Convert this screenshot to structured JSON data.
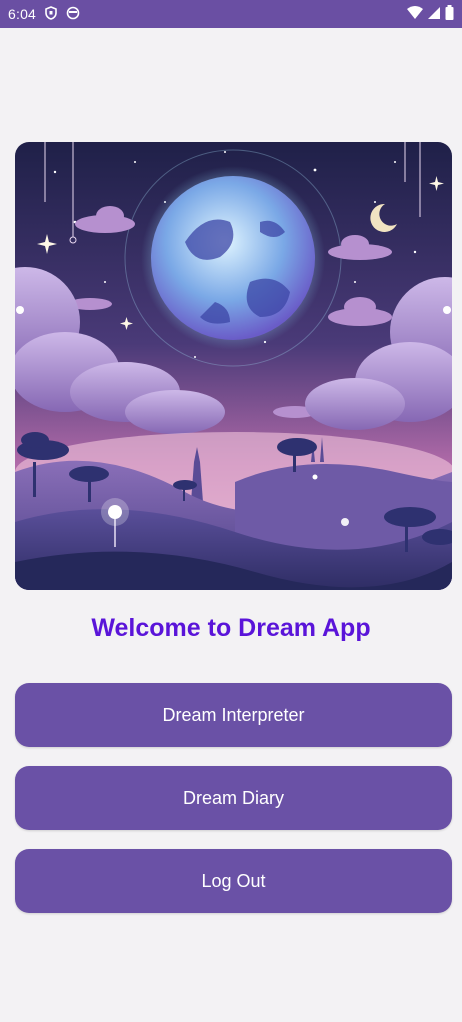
{
  "status_bar": {
    "time": "6:04",
    "icons": [
      "shield-notification-icon",
      "circle-notification-icon",
      "wifi-icon",
      "signal-icon",
      "battery-icon"
    ]
  },
  "hero": {
    "alt": "dream-moon-landscape-illustration"
  },
  "welcome": {
    "text": "Welcome to Dream App"
  },
  "buttons": {
    "interpreter": "Dream Interpreter",
    "diary": "Dream Diary",
    "logout": "Log Out"
  },
  "colors": {
    "status_bar": "#6a4fa3",
    "background": "#f3f2f4",
    "button": "#6a51a6",
    "title": "#5a14d9"
  }
}
